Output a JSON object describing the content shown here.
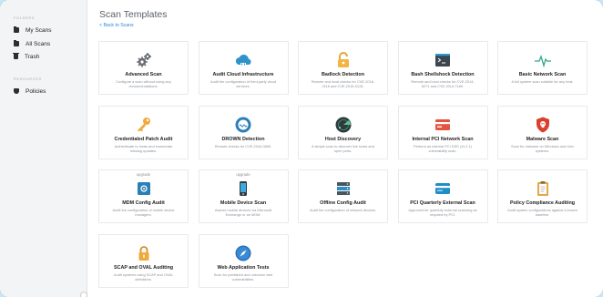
{
  "sidebar": {
    "folders_heading": "FOLDERS",
    "items": [
      {
        "label": "My Scans",
        "icon": "folder-icon"
      },
      {
        "label": "All Scans",
        "icon": "folder-icon"
      },
      {
        "label": "Trash",
        "icon": "trash-icon"
      }
    ],
    "resources_heading": "RESOURCES",
    "resources": [
      {
        "label": "Policies",
        "icon": "shield-icon"
      }
    ]
  },
  "header": {
    "title": "Scan Templates",
    "back_link": "< Back to Scans"
  },
  "templates": [
    {
      "title": "Advanced Scan",
      "desc": "Configure a scan without using any recommendations.",
      "icon": "gears-icon",
      "upgrade": ""
    },
    {
      "title": "Audit Cloud Infrastructure",
      "desc": "Audit the configuration of third-party cloud services.",
      "icon": "cloud-icon",
      "upgrade": ""
    },
    {
      "title": "Badlock Detection",
      "desc": "Remote and local checks for CVE-2016-2118 and CVE-2016-0128.",
      "icon": "padlock-icon",
      "upgrade": ""
    },
    {
      "title": "Bash Shellshock Detection",
      "desc": "Remote and local checks for CVE-2014-6271 and CVE-2014-7169.",
      "icon": "terminal-icon",
      "upgrade": ""
    },
    {
      "title": "Basic Network Scan",
      "desc": "A full system scan suitable for any host.",
      "icon": "pulse-icon",
      "upgrade": ""
    },
    {
      "title": "Credentialed Patch Audit",
      "desc": "Authenticate to hosts and enumerate missing updates.",
      "icon": "key-icon",
      "upgrade": ""
    },
    {
      "title": "DROWN Detection",
      "desc": "Remote checks for CVE-2016-0800.",
      "icon": "drown-icon",
      "upgrade": ""
    },
    {
      "title": "Host Discovery",
      "desc": "A simple scan to discover live hosts and open ports.",
      "icon": "radar-icon",
      "upgrade": ""
    },
    {
      "title": "Internal PCI Network Scan",
      "desc": "Perform an internal PCI DSS (11.2.1) vulnerability scan.",
      "icon": "card-icon",
      "upgrade": ""
    },
    {
      "title": "Malware Scan",
      "desc": "Scan for malware on Windows and Unix systems.",
      "icon": "malware-shield-icon",
      "upgrade": ""
    },
    {
      "title": "MDM Config Audit",
      "desc": "Audit the configuration of mobile device managers.",
      "icon": "mdm-icon",
      "upgrade": "upgrade"
    },
    {
      "title": "Mobile Device Scan",
      "desc": "Assess mobile devices via Microsoft Exchange or an MDM.",
      "icon": "mobile-icon",
      "upgrade": "upgrade"
    },
    {
      "title": "Offline Config Audit",
      "desc": "Audit the configuration of network devices.",
      "icon": "server-rack-icon",
      "upgrade": ""
    },
    {
      "title": "PCI Quarterly External Scan",
      "desc": "Approved for quarterly external scanning as required by PCI.",
      "icon": "credit-card-icon",
      "upgrade": ""
    },
    {
      "title": "Policy Compliance Auditing",
      "desc": "Audit system configurations against a known baseline.",
      "icon": "clipboard-icon",
      "upgrade": ""
    },
    {
      "title": "SCAP and OVAL Auditing",
      "desc": "Audit systems using SCAP and OVAL definitions.",
      "icon": "lock-icon",
      "upgrade": ""
    },
    {
      "title": "Web Application Tests",
      "desc": "Scan for published and unknown web vulnerabilities.",
      "icon": "compass-icon",
      "upgrade": ""
    }
  ],
  "colors": {
    "link": "#2d89d8",
    "sidebar_bg": "#f3f4f5",
    "outer_bg": "#c9e6f5"
  }
}
